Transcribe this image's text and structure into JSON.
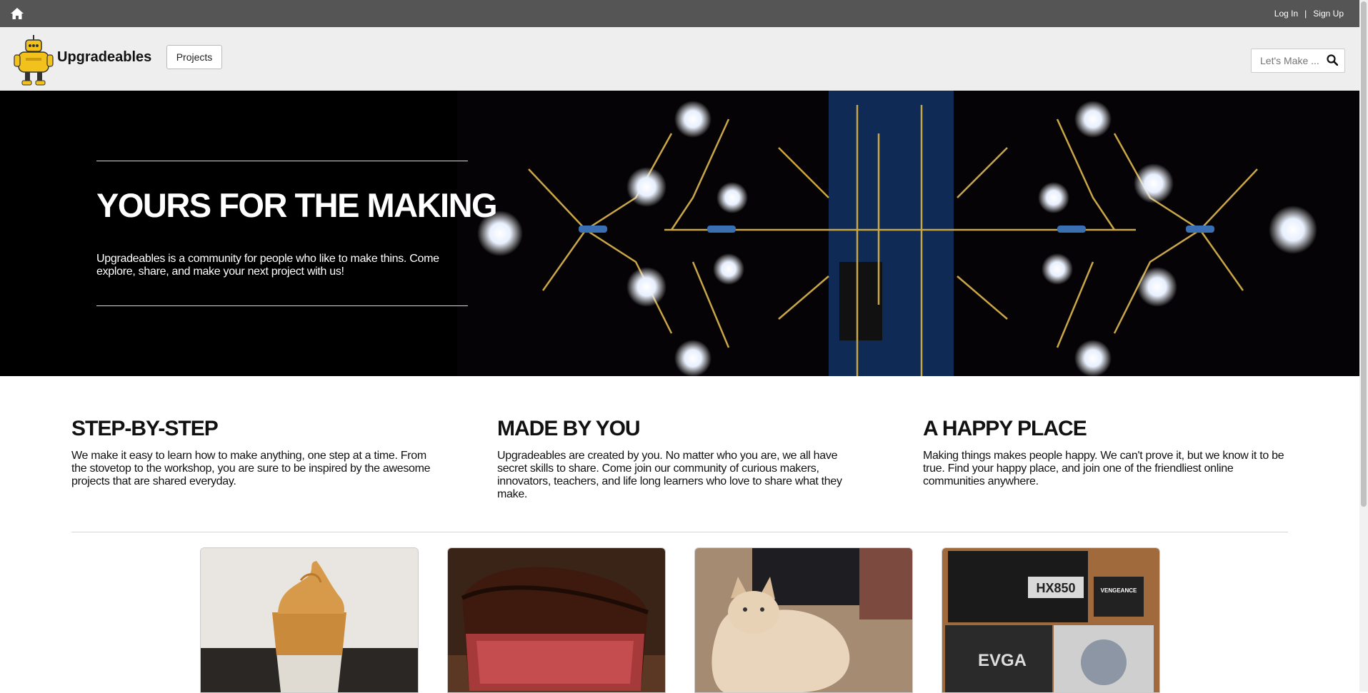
{
  "topbar": {
    "home_icon": "home-icon",
    "login_label": "Log In",
    "separator": "|",
    "signup_label": "Sign Up"
  },
  "header": {
    "logo_icon": "robot-mascot-logo",
    "brand_name": "Upgradeables",
    "projects_label": "Projects",
    "search_placeholder": "Let's Make ...",
    "search_icon": "search-icon"
  },
  "hero": {
    "title": "YOURS FOR THE MAKING",
    "text": "Upgradeables is a community for people who like to make thins. Come explore, share, and make your next project with us!"
  },
  "features": [
    {
      "title": "STEP-BY-STEP",
      "text": "We make it easy to learn how to make anything, one step at a time. From the stovetop to the workshop, you are sure to be inspired by the awesome projects that are shared everyday."
    },
    {
      "title": "MADE BY YOU",
      "text": "Upgradeables are created by you. No matter who you are, we all have secret skills to share. Come join our community of curious makers, innovators, teachers, and life long learners who love to share what they make."
    },
    {
      "title": "A HAPPY PLACE",
      "text": "Making things makes people happy. We can't prove it, but we know it to be true. Find your happy place, and join one of the friendliest online communities anywhere."
    }
  ],
  "projects": {
    "cards": [
      {
        "image": "dalgona-coffee-photo"
      },
      {
        "image": "steak-photo"
      },
      {
        "image": "cat-photo"
      },
      {
        "image": "pc-parts-photo",
        "label_1": "HX850",
        "label_2": "VENGEANCE",
        "label_3": "EVGA"
      }
    ]
  },
  "colors": {
    "topbar": "#555555",
    "header": "#eeeeee",
    "hero": "#000000"
  }
}
